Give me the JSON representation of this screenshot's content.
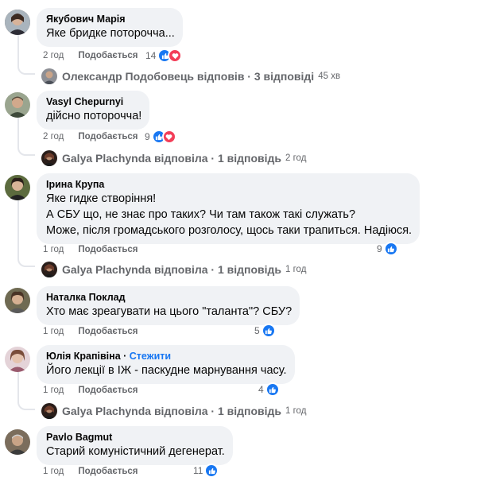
{
  "comments": [
    {
      "author": "Якубович Марія",
      "lines": [
        "Яке бридке поторочча..."
      ],
      "time": "2 год",
      "like_label": "Подобається",
      "reactions": "14",
      "replies": {
        "text": "Олександр Подобовець відповів · 3 відповіді",
        "time": "45 хв"
      }
    },
    {
      "author": "Vasyl Chepurnyi",
      "lines": [
        "дійсно поторочча!"
      ],
      "time": "2 год",
      "like_label": "Подобається",
      "reactions": "9",
      "replies": {
        "text": "Galya Plachynda відповіла · 1 відповідь",
        "time": "2 год"
      }
    },
    {
      "author": "Ірина Крупа",
      "lines": [
        "Яке гидке створіння!",
        "А СБУ що, не знає про таких? Чи там також такі служать?",
        "Може, після громадського розголосу, щось таки трапиться. Надіюся."
      ],
      "time": "1 год",
      "like_label": "Подобається",
      "reactions": "9",
      "replies": {
        "text": "Galya Plachynda відповіла · 1 відповідь",
        "time": "1 год"
      }
    },
    {
      "author": "Наталка Поклад",
      "lines": [
        "Хто має зреагувати на цього \"таланта\"? СБУ?"
      ],
      "time": "1 год",
      "like_label": "Подобається",
      "reactions": "5"
    },
    {
      "author": "Юлія Крапівіна",
      "follow": "Стежити",
      "lines": [
        "Його лекції в ІЖ - паскудне марнування часу."
      ],
      "time": "1 год",
      "like_label": "Подобається",
      "reactions": "4",
      "replies": {
        "text": "Galya Plachynda відповіла · 1 відповідь",
        "time": "1 год"
      }
    },
    {
      "author": "Pavlo Bagmut",
      "lines": [
        "Старий комуністичний дегенерат."
      ],
      "time": "1 год",
      "like_label": "Подобається",
      "reactions": "11"
    }
  ],
  "icons": {
    "like": "thumbs-up-icon",
    "love": "heart-icon"
  },
  "colors": {
    "bubble": "#f0f2f5",
    "accent": "#1877f2",
    "love": "#f33e58",
    "meta": "#65676b"
  }
}
